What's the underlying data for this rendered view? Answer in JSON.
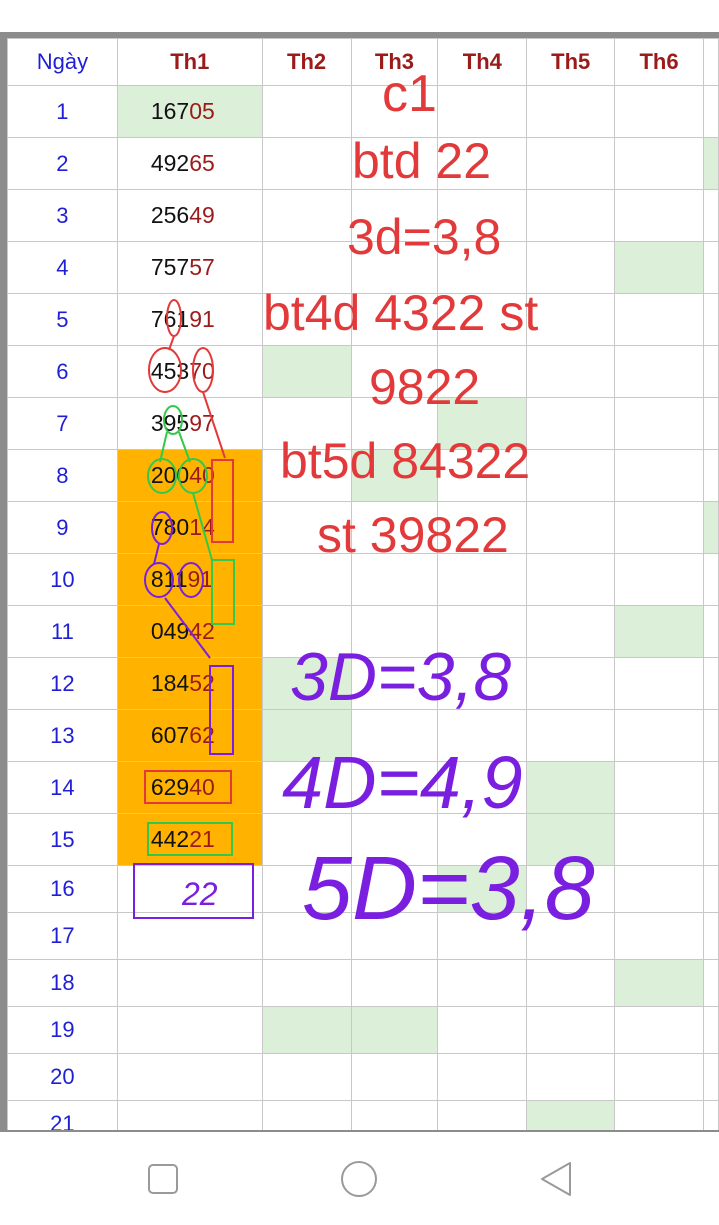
{
  "header": {
    "day": "Ngày",
    "cols": [
      "Th1",
      "Th2",
      "Th3",
      "Th4",
      "Th5",
      "Th6"
    ]
  },
  "rows": [
    {
      "day": "1",
      "head": "167",
      "tail": "05"
    },
    {
      "day": "2",
      "head": "492",
      "tail": "65"
    },
    {
      "day": "3",
      "head": "256",
      "tail": "49"
    },
    {
      "day": "4",
      "head": "757",
      "tail": "57"
    },
    {
      "day": "5",
      "head": "761",
      "tail": "91"
    },
    {
      "day": "6",
      "head": "453",
      "tail": "70"
    },
    {
      "day": "7",
      "head": "395",
      "tail": "97"
    },
    {
      "day": "8",
      "head": "200",
      "tail": "40"
    },
    {
      "day": "9",
      "head": "780",
      "tail": "14"
    },
    {
      "day": "10",
      "head": "811",
      "tail": "91"
    },
    {
      "day": "11",
      "head": "049",
      "tail": "42"
    },
    {
      "day": "12",
      "head": "184",
      "tail": "52"
    },
    {
      "day": "13",
      "head": "607",
      "tail": "62"
    },
    {
      "day": "14",
      "head": "629",
      "tail": "40"
    },
    {
      "day": "15",
      "head": "442",
      "tail": "21"
    },
    {
      "day": "16",
      "head": "",
      "tail": ""
    },
    {
      "day": "17",
      "head": "",
      "tail": ""
    },
    {
      "day": "18",
      "head": "",
      "tail": ""
    },
    {
      "day": "19",
      "head": "",
      "tail": ""
    },
    {
      "day": "20",
      "head": "",
      "tail": ""
    },
    {
      "day": "21",
      "head": "",
      "tail": ""
    }
  ],
  "annotations": {
    "typed": [
      "c1",
      "btd 22",
      "3d=3,8",
      "bt4d 4322 st",
      "9822",
      "bt5d 84322",
      "st 39822"
    ],
    "handwritten": [
      "3D=3,8",
      "4D=4,9",
      "5D=3,8"
    ],
    "box_note": "22"
  },
  "nav": {
    "back_icon": "triangle-back-icon",
    "home_icon": "circle-home-icon",
    "recent_icon": "square-recent-icon"
  },
  "colors": {
    "highlight_green": "#dcefd8",
    "highlight_orange": "#ffb300",
    "typed_red": "#e23a3a",
    "handwritten_purple": "#7a1fe0"
  }
}
